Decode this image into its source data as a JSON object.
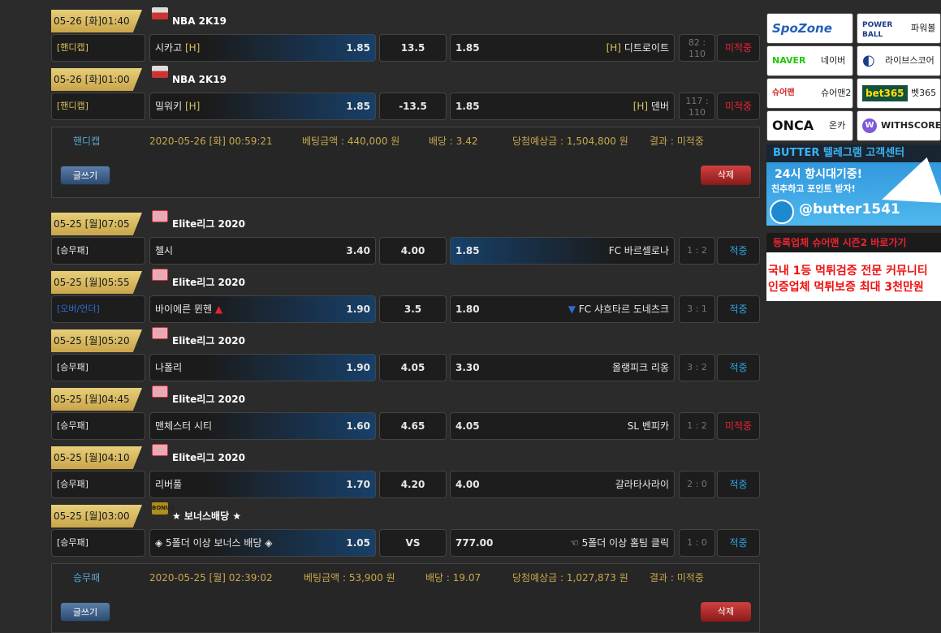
{
  "bets": [
    {
      "league_icon": "ic-nba",
      "league": "NBA 2K19",
      "rows": [
        {
          "date": "05-26 [화]01:40",
          "type": "[핸디캡]",
          "type_color": "tan",
          "home": "시카고",
          "home_tag": "[H]",
          "home_odds": "1.85",
          "draw": "13.5",
          "away_odds": "1.85",
          "away_tag": "[H]",
          "away": "디트로이트",
          "score": "82 : 110",
          "result": "미적중",
          "result_color": "red",
          "pick": "home"
        }
      ]
    },
    {
      "league_icon": "ic-nba",
      "league": "NBA 2K19",
      "rows": [
        {
          "date": "05-26 [화]01:00",
          "type": "[핸디캡]",
          "type_color": "tan",
          "home": "밀워키",
          "home_tag": "[H]",
          "home_odds": "1.85",
          "draw": "-13.5",
          "away_odds": "1.85",
          "away_tag": "[H]",
          "away": "덴버",
          "score": "117 : 110",
          "result": "미적중",
          "result_color": "red",
          "pick": "home"
        }
      ]
    }
  ],
  "summary1": {
    "type": "핸디캡",
    "datetime": "2020-05-26 [화] 00:59:21",
    "amount": "베팅금액 : 440,000 원",
    "odds": "배당 : 3.42",
    "expected": "당첨예상금 : 1,504,800 원",
    "result": "결과 : 미적중",
    "write_btn": "글쓰기",
    "delete_btn": "삭제"
  },
  "bets2": [
    {
      "date": "05-25 [월]07:05",
      "league": "Elite리그 2020",
      "type": "[승무패]",
      "home": "첼시",
      "home_odds": "3.40",
      "draw": "4.00",
      "away_odds": "1.85",
      "away": "FC 바르셀로나",
      "score": "1 : 2",
      "result": "적중"
    },
    {
      "date": "05-25 [월]05:55",
      "league": "Elite리그 2020",
      "type": "[오버/언더]",
      "home": "바이에른 뮌헨",
      "home_mark": "▲",
      "home_odds": "1.90",
      "draw": "3.5",
      "away_odds": "1.80",
      "away_mark": "▼",
      "away": "FC 샤흐타르 도네츠크",
      "score": "3 : 1",
      "result": "적중"
    },
    {
      "date": "05-25 [월]05:20",
      "league": "Elite리그 2020",
      "type": "[승무패]",
      "home": "나폴리",
      "home_odds": "1.90",
      "draw": "4.05",
      "away_odds": "3.30",
      "away": "올랭피크 리옹",
      "score": "3 : 2",
      "result": "적중"
    },
    {
      "date": "05-25 [월]04:45",
      "league": "Elite리그 2020",
      "type": "[승무패]",
      "home": "맨체스터 시티",
      "home_odds": "1.60",
      "draw": "4.65",
      "away_odds": "4.05",
      "away": "SL 벤피카",
      "score": "1 : 2",
      "result": "미적중"
    },
    {
      "date": "05-25 [월]04:10",
      "league": "Elite리그 2020",
      "type": "[승무패]",
      "home": "리버풀",
      "home_odds": "1.70",
      "draw": "4.20",
      "away_odds": "4.00",
      "away": "갈라타사라이",
      "score": "2 : 0",
      "result": "적중"
    },
    {
      "date": "05-25 [월]03:00",
      "league": "★ 보너스배당 ★",
      "icon_text": "BONUS",
      "type": "[승무패]",
      "home": "◈ 5폴더 이상 보너스 배당 ◈",
      "home_odds": "1.05",
      "draw": "VS",
      "away_odds": "777.00",
      "away": "☜ 5폴더 이상 홈팀 클릭",
      "score": "1 : 0",
      "result": "적중"
    }
  ],
  "summary2": {
    "type": "승무패",
    "datetime": "2020-05-25 [월] 02:39:02",
    "amount": "베팅금액 : 53,900 원",
    "odds": "배당 : 19.07",
    "expected": "당첨예상금 : 1,027,873 원",
    "result": "결과 : 미적중",
    "write_btn": "글쓰기",
    "delete_btn": "삭제"
  },
  "ads": [
    {
      "logo": "SpoZone",
      "name": ""
    },
    {
      "logo": "POWER BALL",
      "name": "파워볼"
    },
    {
      "logo": "NAVER",
      "name": "네이버"
    },
    {
      "logo": "◐",
      "name": "라이브스코어"
    },
    {
      "logo": "슈어맨",
      "name": "슈어맨2"
    },
    {
      "logo": "bet365",
      "name": "벳365"
    },
    {
      "logo": "ONCA",
      "name": "온카"
    },
    {
      "logo": "W",
      "name": "WITHSCORE"
    }
  ],
  "banner_telegram": {
    "title": "BUTTER 텔레그램 고객센터",
    "line1": "24시 항시대기중!",
    "line2": "친추하고 포인트 받자!",
    "handle": "@butter1541"
  },
  "banner_sureman": {
    "title": "등록업체 슈어맨 시즌2 바로가기",
    "line1": "국내 1등 먹튀검증 전문 커뮤니티",
    "line2": "인증업체 먹튀보증 최대 3천만원"
  }
}
